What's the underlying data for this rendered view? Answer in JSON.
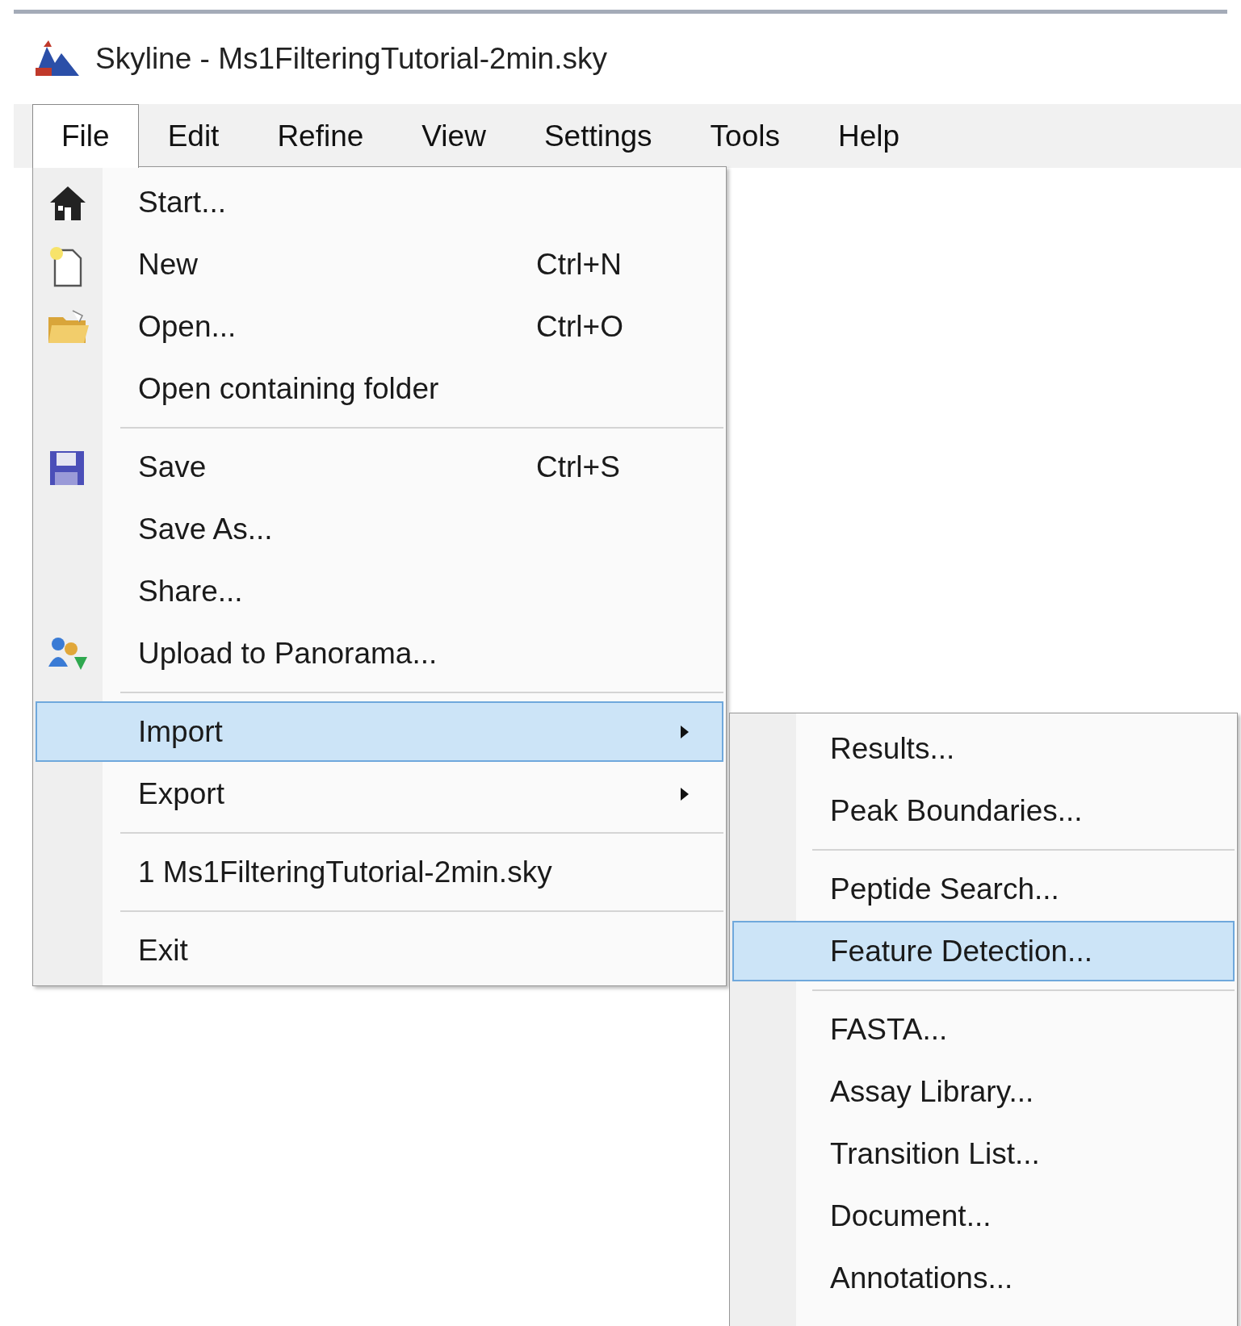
{
  "window": {
    "title": "Skyline - Ms1FilteringTutorial-2min.sky"
  },
  "menu_bar": [
    {
      "label": "File",
      "selected": true
    },
    {
      "label": "Edit",
      "selected": false
    },
    {
      "label": "Refine",
      "selected": false
    },
    {
      "label": "View",
      "selected": false
    },
    {
      "label": "Settings",
      "selected": false
    },
    {
      "label": "Tools",
      "selected": false
    },
    {
      "label": "Help",
      "selected": false
    }
  ],
  "file_menu": {
    "items": [
      {
        "kind": "item",
        "label": "Start...",
        "selected": false
      },
      {
        "kind": "item",
        "label": "New",
        "shortcut": "Ctrl+N",
        "selected": false
      },
      {
        "kind": "item",
        "label": "Open...",
        "shortcut": "Ctrl+O",
        "selected": false
      },
      {
        "kind": "item",
        "label": "Open containing folder",
        "selected": false
      },
      {
        "kind": "separator"
      },
      {
        "kind": "item",
        "label": "Save",
        "shortcut": "Ctrl+S",
        "selected": false
      },
      {
        "kind": "item",
        "label": "Save As...",
        "selected": false
      },
      {
        "kind": "item",
        "label": "Share...",
        "selected": false
      },
      {
        "kind": "item",
        "label": "Upload to Panorama...",
        "selected": false
      },
      {
        "kind": "separator"
      },
      {
        "kind": "submenu",
        "label": "Import",
        "selected": true
      },
      {
        "kind": "submenu",
        "label": "Export",
        "selected": false
      },
      {
        "kind": "separator"
      },
      {
        "kind": "item",
        "label": "1 Ms1FilteringTutorial-2min.sky",
        "selected": false
      },
      {
        "kind": "separator"
      },
      {
        "kind": "item",
        "label": "Exit",
        "selected": false
      }
    ]
  },
  "import_submenu": {
    "items": [
      {
        "kind": "item",
        "label": "Results...",
        "selected": false
      },
      {
        "kind": "item",
        "label": "Peak Boundaries...",
        "selected": false
      },
      {
        "kind": "separator"
      },
      {
        "kind": "item",
        "label": "Peptide Search...",
        "selected": false
      },
      {
        "kind": "item",
        "label": "Feature Detection...",
        "selected": true
      },
      {
        "kind": "separator"
      },
      {
        "kind": "item",
        "label": "FASTA...",
        "selected": false
      },
      {
        "kind": "item",
        "label": "Assay Library...",
        "selected": false
      },
      {
        "kind": "item",
        "label": "Transition List...",
        "selected": false
      },
      {
        "kind": "item",
        "label": "Document...",
        "selected": false
      },
      {
        "kind": "item",
        "label": "Annotations...",
        "selected": false
      }
    ]
  }
}
